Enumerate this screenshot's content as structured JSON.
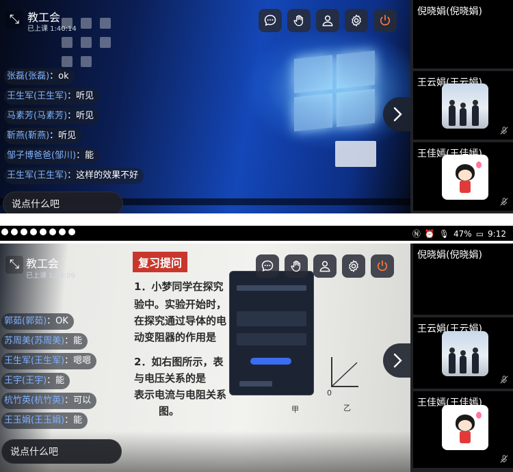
{
  "top": {
    "room_title": "教工会",
    "room_status": "已上课 1:40:14",
    "chat": [
      {
        "name": "张磊(张磊)",
        "text": "ok"
      },
      {
        "name": "王生军(王生军)",
        "text": "听见"
      },
      {
        "name": "马素芳(马素芳)",
        "text": "听见"
      },
      {
        "name": "靳燕(靳燕)",
        "text": "听见"
      },
      {
        "name": "邹子博爸爸(邹川)",
        "text": "能"
      },
      {
        "name": "王生军(王生军)",
        "text": "这样的效果不好"
      }
    ],
    "chat_placeholder": "说点什么吧",
    "participants": [
      {
        "name": "倪晓娟(倪晓娟)"
      },
      {
        "name": "王云娟(王云娟)"
      },
      {
        "name": "王佳嫣(王佳嫣)"
      }
    ]
  },
  "status_bar": {
    "battery": "47%",
    "time": "9:12"
  },
  "bottom": {
    "room_title": "教工会",
    "room_status": "已上课 1:24:09",
    "worksheet": {
      "title": "复习提问",
      "lines": [
        "1．小梦同学在探究",
        "验中。实验开始时，",
        "在探究通过导体的电",
        "动变阻器的作用是",
        "2．如右图所示，表",
        "与电压关系的是",
        "表示电流与电阻关系",
        "图。"
      ],
      "graph_labels": [
        "甲",
        "乙",
        "0"
      ]
    },
    "chat": [
      {
        "name": "郭茹(郭茹)",
        "text": "OK"
      },
      {
        "name": "苏周美(苏周美)",
        "text": "能"
      },
      {
        "name": "王生军(王生军)",
        "text": "嗯嗯"
      },
      {
        "name": "王宇(王宇)",
        "text": "能"
      },
      {
        "name": "杭竹英(杭竹英)",
        "text": "可以"
      },
      {
        "name": "王玉娟(王玉娟)",
        "text": "能"
      }
    ],
    "chat_placeholder": "说点什么吧",
    "participants": [
      {
        "name": "倪晓娟(倪晓娟)"
      },
      {
        "name": "王云娟(王云娟)"
      },
      {
        "name": "王佳嫣(王佳嫣)"
      }
    ]
  },
  "icons": [
    "collapse-icon",
    "chat-icon",
    "raise-hand-icon",
    "user-icon",
    "gear-icon",
    "power-icon",
    "chevron-right-icon",
    "mic-off-icon"
  ],
  "colors": {
    "accent_orange": "#ff7a3d",
    "chat_name": "#7fb2ff",
    "panel_dark": "#202225"
  }
}
